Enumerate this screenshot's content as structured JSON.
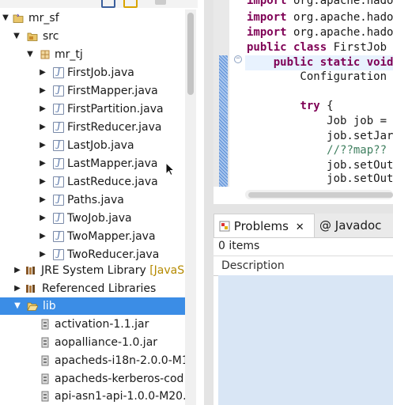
{
  "explorer": {
    "project": "mr_sf",
    "src_folder": "src",
    "package": "mr_tj",
    "files": [
      "FirstJob.java",
      "FirstMapper.java",
      "FirstPartition.java",
      "FirstReducer.java",
      "LastJob.java",
      "LastMapper.java",
      "LastReduce.java",
      "Paths.java",
      "TwoJob.java",
      "TwoMapper.java",
      "TwoReducer.java"
    ],
    "jre_label": "JRE System Library",
    "jre_decoration": "[JavaS",
    "ref_libs": "Referenced Libraries",
    "lib_folder": "lib",
    "jars": [
      "activation-1.1.jar",
      "aopalliance-1.0.jar",
      "apacheds-i18n-2.0.0-M1",
      "apacheds-kerberos-cod",
      "api-asn1-api-1.0.0-M20."
    ]
  },
  "editor": {
    "lines": [
      [
        [
          "kw",
          "import"
        ],
        [
          "t",
          " org.apache.hado"
        ]
      ],
      [
        [
          "kw",
          "import"
        ],
        [
          "t",
          " org.apache.hado"
        ]
      ],
      [
        [
          "kw",
          "import"
        ],
        [
          "t",
          " org.apache.hado"
        ]
      ],
      [
        [
          "kw",
          "public"
        ],
        [
          "t",
          " "
        ],
        [
          "kw",
          "class"
        ],
        [
          "t",
          " FirstJob"
        ]
      ],
      [
        [
          "t",
          "    "
        ],
        [
          "kw",
          "public"
        ],
        [
          "t",
          " "
        ],
        [
          "kw",
          "static"
        ],
        [
          "t",
          " "
        ],
        [
          "kw",
          "void"
        ]
      ],
      [
        [
          "t",
          "        Configuration"
        ]
      ],
      [
        [
          "t",
          ""
        ]
      ],
      [
        [
          "t",
          "        "
        ],
        [
          "kw",
          "try"
        ],
        [
          "t",
          " {"
        ]
      ],
      [
        [
          "t",
          "            Job job ="
        ]
      ],
      [
        [
          "t",
          "            job.setJar"
        ]
      ],
      [
        [
          "t",
          "            "
        ],
        [
          "cm",
          "//??map??"
        ]
      ],
      [
        [
          "t",
          "            job.setOut"
        ]
      ],
      [
        [
          "t",
          "            job.setOut"
        ]
      ]
    ]
  },
  "problems": {
    "tabs": [
      "Problems",
      "@ Javadoc"
    ],
    "count": "0 items",
    "column_description": "Description"
  },
  "colors": {
    "selection": "#3b8de6",
    "keyword": "#7f0055",
    "comment": "#3f7f5f"
  }
}
